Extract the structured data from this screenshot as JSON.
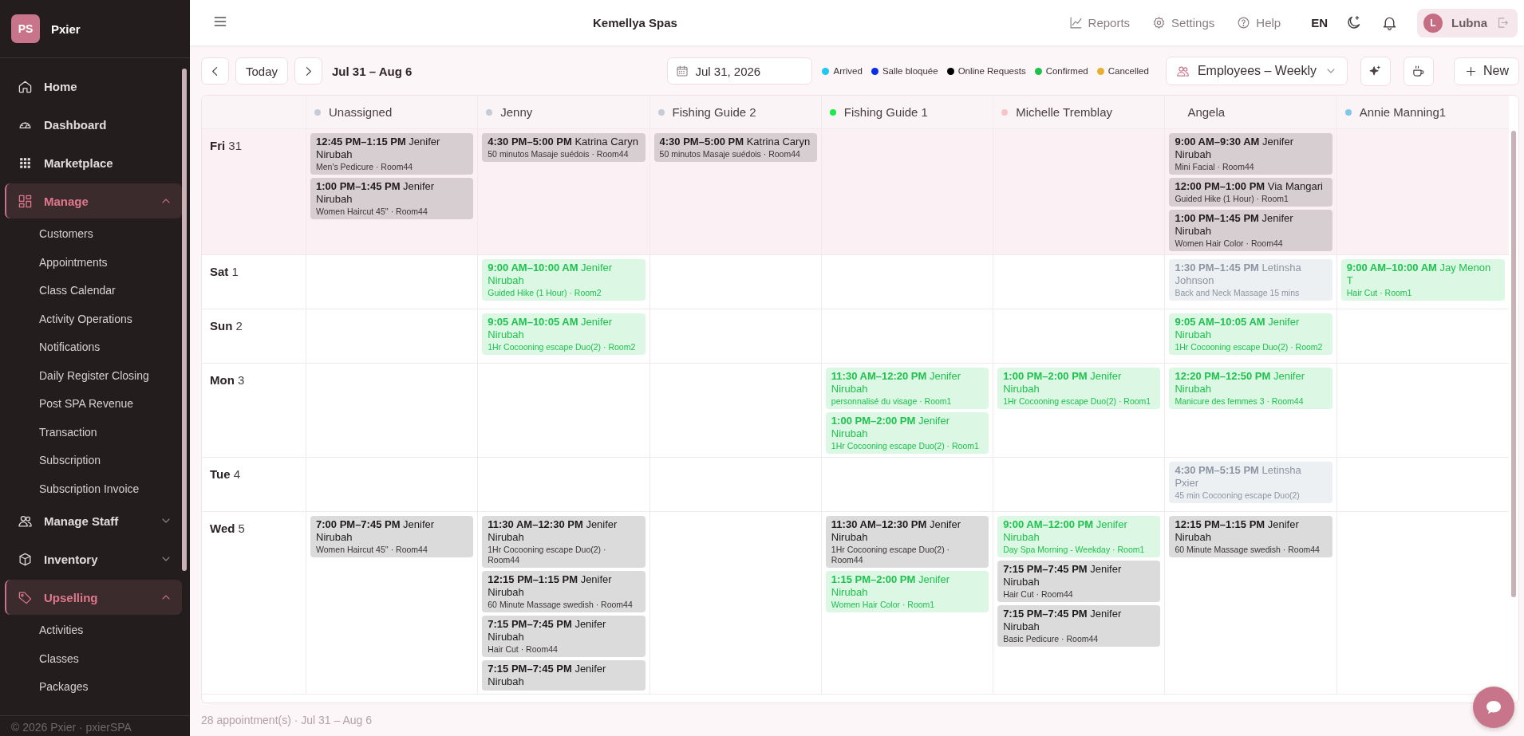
{
  "sidebar": {
    "logo": "PS",
    "brand": "Pxier",
    "items": [
      {
        "label": "Home",
        "kind": "link"
      },
      {
        "label": "Dashboard",
        "kind": "link"
      },
      {
        "label": "Marketplace",
        "kind": "link"
      },
      {
        "label": "Manage",
        "kind": "group",
        "expanded": true,
        "children": [
          {
            "label": "Customers"
          },
          {
            "label": "Appointments"
          },
          {
            "label": "Class Calendar"
          },
          {
            "label": "Activity Operations"
          },
          {
            "label": "Notifications"
          },
          {
            "label": "Daily Register Closing"
          },
          {
            "label": "Post SPA Revenue"
          },
          {
            "label": "Transaction"
          },
          {
            "label": "Subscription"
          },
          {
            "label": "Subscription Invoice"
          }
        ]
      },
      {
        "label": "Manage Staff",
        "kind": "group",
        "expanded": false
      },
      {
        "label": "Inventory",
        "kind": "group",
        "expanded": false
      },
      {
        "label": "Upselling",
        "kind": "group",
        "expanded": true,
        "children": [
          {
            "label": "Activities"
          },
          {
            "label": "Classes"
          },
          {
            "label": "Packages"
          }
        ]
      }
    ],
    "footer": "© 2026 Pxier · pxierSPA"
  },
  "header": {
    "title": "Kemellya Spas",
    "links": [
      {
        "label": "Reports"
      },
      {
        "label": "Settings"
      },
      {
        "label": "Help"
      }
    ],
    "language": "EN",
    "user": {
      "initial": "L",
      "name": "Lubna"
    }
  },
  "toolbar": {
    "today": "Today",
    "range": "Jul 31 – Aug 6",
    "date": "Jul 31, 2026",
    "legend": [
      {
        "label": "Arrived",
        "color": "#1ec8f0"
      },
      {
        "label": "Salle bloquée",
        "color": "#0a2ee8"
      },
      {
        "label": "Online Requests",
        "color": "#000000"
      },
      {
        "label": "Confirmed",
        "color": "#1ec24a"
      },
      {
        "label": "Cancelled",
        "color": "#e8b030"
      }
    ],
    "view": "Employees – Weekly",
    "new": "New"
  },
  "calendar": {
    "columns": [
      {
        "name": "Unassigned",
        "color": "#c4ccd8"
      },
      {
        "name": "Jenny",
        "color": "#c4ccd8"
      },
      {
        "name": "Fishing Guide 2",
        "color": "#c4ccd8"
      },
      {
        "name": "Fishing Guide 1",
        "color": "#1ee84a"
      },
      {
        "name": "Michelle Tremblay",
        "color": "#f8c4cc"
      },
      {
        "name": "Angela"
      },
      {
        "name": "Annie Manning1",
        "color": "#80c8e8"
      }
    ],
    "days": [
      {
        "weekday": "Fri",
        "date": "31",
        "today": true,
        "cells": [
          {
            "appointments": [
              {
                "time": "12:45 PM–1:15 PM",
                "client": "Jenifer Nirubah",
                "detail": "Men's Pedicure · Room44",
                "kind": "booked"
              },
              {
                "time": "1:00 PM–1:45 PM",
                "client": "Jenifer Nirubah",
                "detail": "Women Haircut 45'' · Room44",
                "kind": "booked"
              }
            ]
          },
          {
            "appointments": [
              {
                "time": "4:30 PM–5:00 PM",
                "client": "Katrina Caryn",
                "detail": "50 minutos Masaje suédois · Room44",
                "kind": "booked"
              }
            ]
          },
          {
            "appointments": [
              {
                "time": "4:30 PM–5:00 PM",
                "client": "Katrina Caryn",
                "detail": "50 minutos Masaje suédois · Room44",
                "kind": "booked"
              }
            ]
          },
          {},
          {},
          {
            "appointments": [
              {
                "time": "9:00 AM–9:30 AM",
                "client": "Jenifer Nirubah",
                "detail": "Mini Facial · Room44",
                "kind": "booked"
              },
              {
                "time": "12:00 PM–1:00 PM",
                "client": "Via Mangari",
                "detail": "Guided Hike (1 Hour) · Room1",
                "kind": "booked"
              },
              {
                "time": "1:00 PM–1:45 PM",
                "client": "Jenifer Nirubah",
                "detail": "Women Hair Color · Room44",
                "kind": "booked"
              }
            ]
          },
          {}
        ]
      },
      {
        "weekday": "Sat",
        "date": "1",
        "today": false,
        "cells": [
          {},
          {
            "appointments": [
              {
                "time": "9:00 AM–10:00 AM",
                "client": "Jenifer Nirubah",
                "detail": "Guided Hike (1 Hour) · Room2",
                "kind": "confirmed"
              }
            ]
          },
          {},
          {},
          {},
          {
            "appointments": [
              {
                "time": "1:30 PM–1:45 PM",
                "client": "Letinsha Johnson",
                "detail": "Back and Neck Massage 15 mins",
                "kind": "inactive"
              }
            ]
          },
          {
            "appointments": [
              {
                "time": "9:00 AM–10:00 AM",
                "client": "Jay Menon T",
                "detail": "Hair Cut · Room1",
                "kind": "confirmed"
              }
            ]
          }
        ]
      },
      {
        "weekday": "Sun",
        "date": "2",
        "today": false,
        "cells": [
          {},
          {
            "appointments": [
              {
                "time": "9:05 AM–10:05 AM",
                "client": "Jenifer Nirubah",
                "detail": "1Hr Cocooning escape Duo(2) · Room2",
                "kind": "confirmed"
              }
            ]
          },
          {},
          {},
          {},
          {
            "appointments": [
              {
                "time": "9:05 AM–10:05 AM",
                "client": "Jenifer Nirubah",
                "detail": "1Hr Cocooning escape Duo(2) · Room2",
                "kind": "confirmed"
              }
            ]
          },
          {}
        ]
      },
      {
        "weekday": "Mon",
        "date": "3",
        "today": false,
        "cells": [
          {},
          {},
          {},
          {
            "appointments": [
              {
                "time": "11:30 AM–12:20 PM",
                "client": "Jenifer Nirubah",
                "detail": "personnalisé du visage · Room1",
                "kind": "confirmed"
              },
              {
                "time": "1:00 PM–2:00 PM",
                "client": "Jenifer Nirubah",
                "detail": "1Hr Cocooning escape Duo(2) · Room1",
                "kind": "confirmed"
              }
            ]
          },
          {
            "appointments": [
              {
                "time": "1:00 PM–2:00 PM",
                "client": "Jenifer Nirubah",
                "detail": "1Hr Cocooning escape Duo(2) · Room1",
                "kind": "confirmed"
              }
            ]
          },
          {
            "appointments": [
              {
                "time": "12:20 PM–12:50 PM",
                "client": "Jenifer Nirubah",
                "detail": "Manicure des femmes 3 · Room44",
                "kind": "confirmed"
              }
            ]
          },
          {}
        ]
      },
      {
        "weekday": "Tue",
        "date": "4",
        "today": false,
        "cells": [
          {},
          {},
          {},
          {},
          {},
          {
            "appointments": [
              {
                "time": "4:30 PM–5:15 PM",
                "client": "Letinsha Pxier",
                "detail": "45 min Cocooning escape Duo(2)",
                "kind": "inactive"
              }
            ]
          },
          {}
        ]
      },
      {
        "weekday": "Wed",
        "date": "5",
        "today": false,
        "cells": [
          {
            "appointments": [
              {
                "time": "7:00 PM–7:45 PM",
                "client": "Jenifer Nirubah",
                "detail": "Women Haircut 45'' · Room44",
                "kind": "booked"
              }
            ]
          },
          {
            "appointments": [
              {
                "time": "11:30 AM–12:30 PM",
                "client": "Jenifer Nirubah",
                "detail": "1Hr Cocooning escape Duo(2) · Room44",
                "kind": "booked"
              },
              {
                "time": "12:15 PM–1:15 PM",
                "client": "Jenifer Nirubah",
                "detail": "60 Minute Massage swedish · Room44",
                "kind": "booked"
              },
              {
                "time": "7:15 PM–7:45 PM",
                "client": "Jenifer Nirubah",
                "detail": "Hair Cut · Room44",
                "kind": "booked"
              },
              {
                "time": "7:15 PM–7:45 PM",
                "client": "Jenifer Nirubah",
                "kind": "booked"
              }
            ]
          },
          {},
          {
            "appointments": [
              {
                "time": "11:30 AM–12:30 PM",
                "client": "Jenifer Nirubah",
                "detail": "1Hr Cocooning escape Duo(2) · Room44",
                "kind": "booked"
              },
              {
                "time": "1:15 PM–2:00 PM",
                "client": "Jenifer Nirubah",
                "detail": "Women Hair Color · Room1",
                "kind": "confirmed"
              }
            ]
          },
          {
            "appointments": [
              {
                "time": "9:00 AM–12:00 PM",
                "client": "Jenifer Nirubah",
                "detail": "Day Spa Morning - Weekday · Room1",
                "kind": "confirmed"
              },
              {
                "time": "7:15 PM–7:45 PM",
                "client": "Jenifer Nirubah",
                "detail": "Hair Cut · Room44",
                "kind": "booked"
              },
              {
                "time": "7:15 PM–7:45 PM",
                "client": "Jenifer Nirubah",
                "detail": "Basic Pedicure · Room44",
                "kind": "booked"
              }
            ]
          },
          {
            "appointments": [
              {
                "time": "12:15 PM–1:15 PM",
                "client": "Jenifer Nirubah",
                "detail": "60 Minute Massage swedish · Room44",
                "kind": "booked"
              }
            ]
          },
          {}
        ]
      }
    ]
  },
  "footer": "28 appointment(s) · Jul 31 – Aug 6"
}
